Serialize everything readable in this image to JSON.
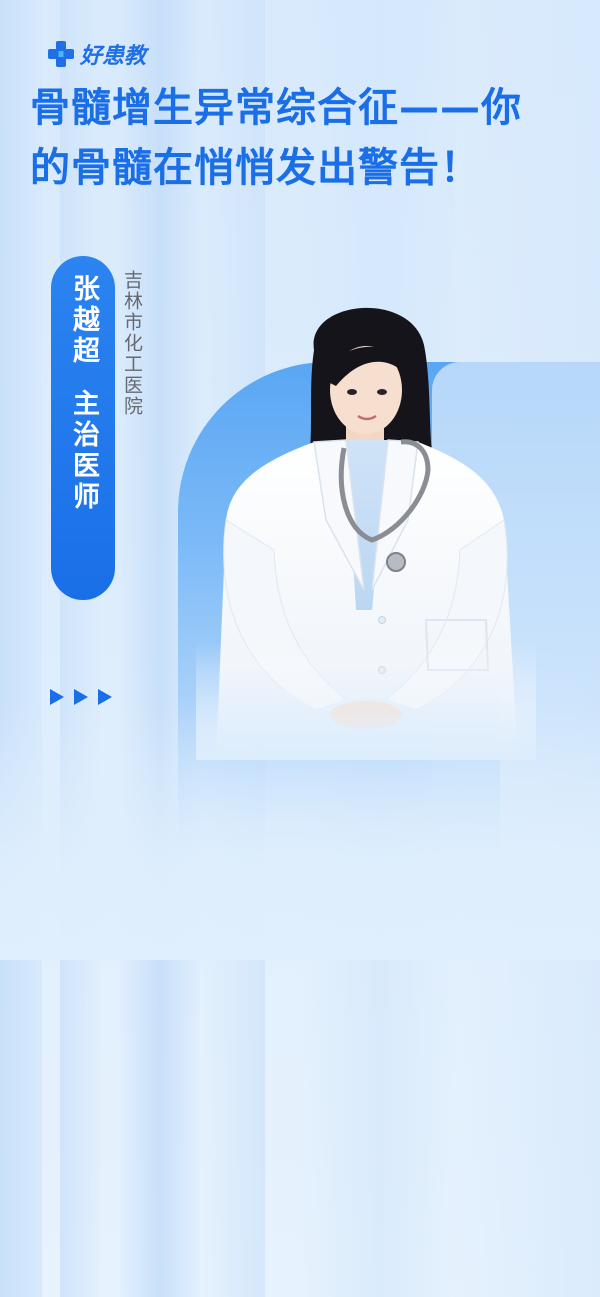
{
  "brand": {
    "name": "好患教",
    "logo_icon": "medical-cross-icon",
    "accent_color": "#1a6fe8"
  },
  "title": {
    "text": "骨髓增生异常综合征——你的骨髓在悄悄发出警告！"
  },
  "doctor": {
    "name": "张越超",
    "position": "主治医师",
    "hospital": "吉林市化工医院",
    "photo_icon": "doctor-portrait"
  },
  "decoration": {
    "arrow_icon": "play-arrow-icon",
    "arrow_count": 3
  }
}
